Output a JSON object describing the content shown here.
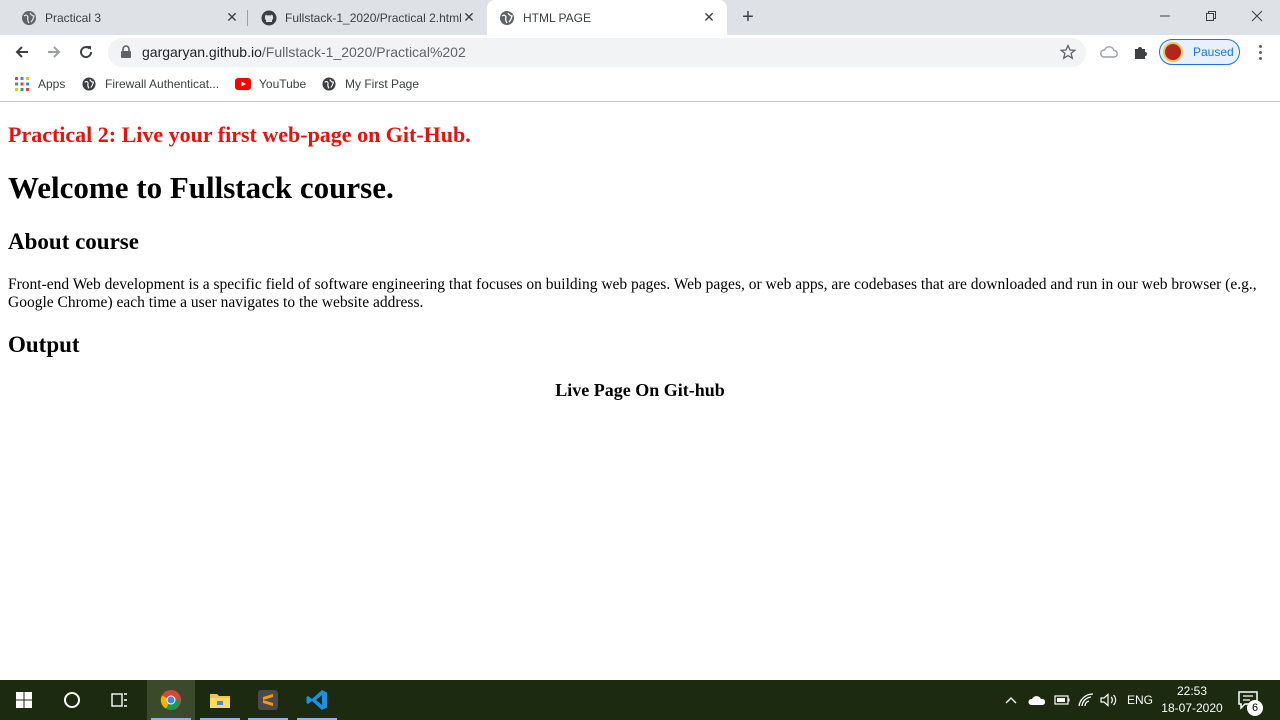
{
  "browser": {
    "tabs": [
      {
        "title": "Practical 3",
        "active": false
      },
      {
        "title": "Fullstack-1_2020/Practical 2.html",
        "active": false
      },
      {
        "title": "HTML PAGE",
        "active": true
      }
    ],
    "new_tab_label": "+",
    "url_host": "gargaryan.github.io",
    "url_path": "/Fullstack-1_2020/Practical%202",
    "profile_status": "Paused",
    "bookmarks": [
      {
        "label": "Apps",
        "icon": "apps-grid-icon"
      },
      {
        "label": "Firewall Authenticat...",
        "icon": "globe-icon"
      },
      {
        "label": "YouTube",
        "icon": "youtube-icon"
      },
      {
        "label": "My First Page",
        "icon": "globe-icon"
      }
    ]
  },
  "page": {
    "practical_heading": "Practical 2: Live your first web-page on Git-Hub.",
    "main_heading": "Welcome to Fullstack course.",
    "about_heading": "About course",
    "about_text": "Front-end Web development is a specific field of software engineering that focuses on building web pages. Web pages, or web apps, are codebases that are downloaded and run in our web browser (e.g., Google Chrome) each time a user navigates to the website address.",
    "output_heading": "Output",
    "output_text": "Live Page On Git-hub"
  },
  "taskbar": {
    "apps": [
      "windows-start-icon",
      "search-cortana-icon",
      "task-view-icon",
      "chrome-icon",
      "file-explorer-icon",
      "sublime-text-icon",
      "vscode-icon"
    ],
    "language": "ENG",
    "time": "22:53",
    "date": "18-07-2020",
    "notification_count": "6"
  },
  "colors": {
    "practical_heading": "#e8110c",
    "tabstrip": "#dee1e6",
    "taskbar": "#1c2a0f",
    "accent": "#1a73e8"
  }
}
